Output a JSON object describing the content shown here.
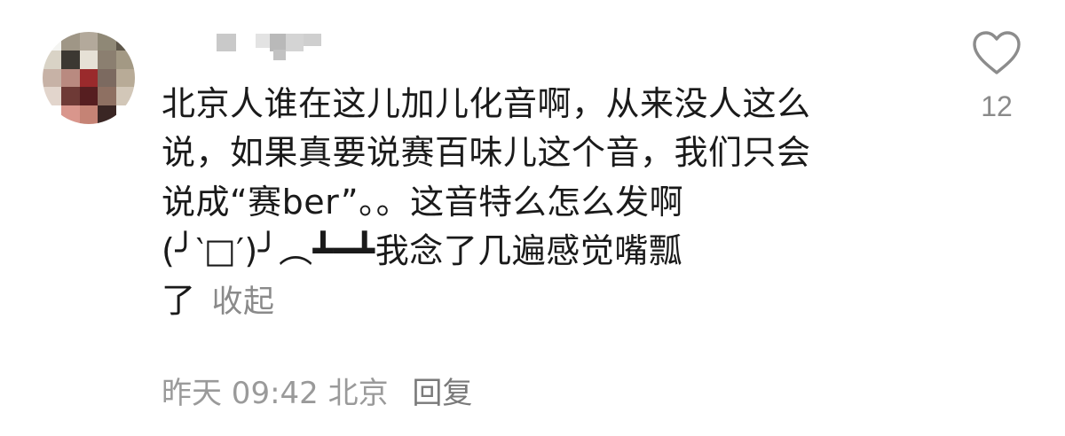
{
  "comment": {
    "lines": [
      "北京人谁在这儿加儿化音啊，从来没人这么",
      "说，如果真要说赛百味儿这个音，我们只会",
      "说成“赛ber”。。这音特么怎么发啊",
      "(╯‵□′)╯︵┻━┻我念了几遍感觉嘴瓢",
      "了"
    ],
    "collapse_label": "收起"
  },
  "meta": {
    "time": "昨天 09:42",
    "location": "北京",
    "reply_label": "回复"
  },
  "like": {
    "icon": "heart-outline-icon",
    "count": "12"
  },
  "colors": {
    "text": "#1a1a1a",
    "secondary": "#9a9a9a",
    "icon": "#8c8c8c"
  }
}
